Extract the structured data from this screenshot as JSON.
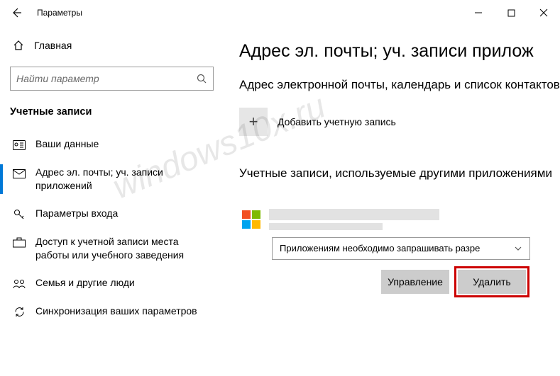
{
  "titlebar": {
    "title": "Параметры"
  },
  "sidebar": {
    "home": "Главная",
    "search_placeholder": "Найти параметр",
    "section": "Учетные записи",
    "items": [
      {
        "label": "Ваши данные"
      },
      {
        "label": "Адрес эл. почты; уч. записи приложений"
      },
      {
        "label": "Параметры входа"
      },
      {
        "label": "Доступ к учетной записи места работы или учебного заведения"
      },
      {
        "label": "Семья и другие люди"
      },
      {
        "label": "Синхронизация ваших параметров"
      }
    ]
  },
  "main": {
    "h1": "Адрес эл. почты; уч. записи прилож",
    "h2": "Адрес электронной почты, календарь и список контактов",
    "add_label": "Добавить учетную запись",
    "h3": "Учетные записи, используемые другими приложениями",
    "dropdown": "Приложениям необходимо запрашивать разре",
    "manage": "Управление",
    "delete": "Удалить"
  },
  "watermark": "windows10x.ru"
}
